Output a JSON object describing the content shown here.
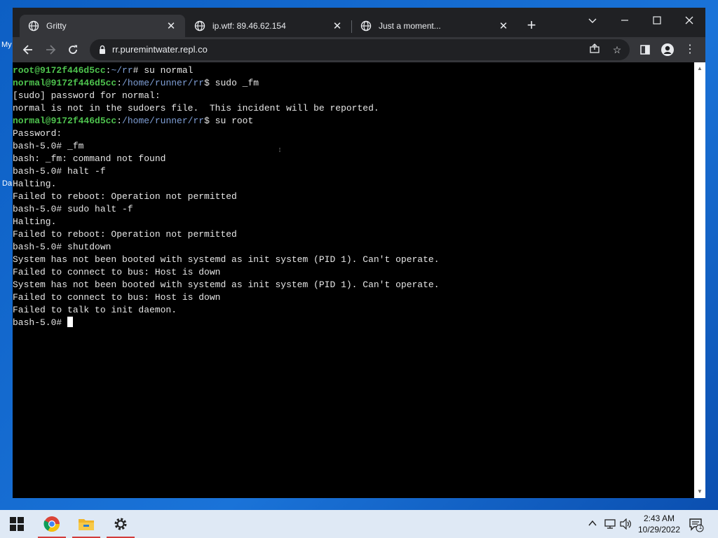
{
  "desktop": {
    "label_my": "My",
    "label_da": "Da"
  },
  "browser": {
    "tabs": [
      {
        "title": "Gritty",
        "active": true
      },
      {
        "title": "ip.wtf: 89.46.62.154",
        "active": false
      },
      {
        "title": "Just a moment...",
        "active": false
      }
    ],
    "address": "rr.puremintwater.repl.co"
  },
  "terminal": {
    "lines": [
      {
        "user": "root@9172f446d5cc",
        "path": "~/rr",
        "suffix": "# su normal"
      },
      {
        "user": "normal@9172f446d5cc",
        "path": "/home/runner/rr",
        "suffix": "$ sudo _fm"
      },
      {
        "text": "[sudo] password for normal:"
      },
      {
        "text": "normal is not in the sudoers file.  This incident will be reported."
      },
      {
        "user": "normal@9172f446d5cc",
        "path": "/home/runner/rr",
        "suffix": "$ su root"
      },
      {
        "text": "Password:"
      },
      {
        "text": "bash-5.0# _fm"
      },
      {
        "text": "bash: _fm: command not found"
      },
      {
        "text": "bash-5.0# halt -f"
      },
      {
        "text": "Halting."
      },
      {
        "text": "Failed to reboot: Operation not permitted"
      },
      {
        "text": "bash-5.0# sudo halt -f"
      },
      {
        "text": "Halting."
      },
      {
        "text": "Failed to reboot: Operation not permitted"
      },
      {
        "text": "bash-5.0# shutdown"
      },
      {
        "text": "System has not been booted with systemd as init system (PID 1). Can't operate."
      },
      {
        "text": "Failed to connect to bus: Host is down"
      },
      {
        "text": "System has not been booted with systemd as init system (PID 1). Can't operate."
      },
      {
        "text": "Failed to connect to bus: Host is down"
      },
      {
        "text": "Failed to talk to init daemon."
      },
      {
        "text": "bash-5.0# "
      }
    ]
  },
  "taskbar": {
    "apps": [
      "start-icon",
      "chrome-icon",
      "file-explorer-icon",
      "settings-icon"
    ],
    "clock_time": "2:43 AM",
    "clock_date": "10/29/2022",
    "notification_count": "1"
  }
}
